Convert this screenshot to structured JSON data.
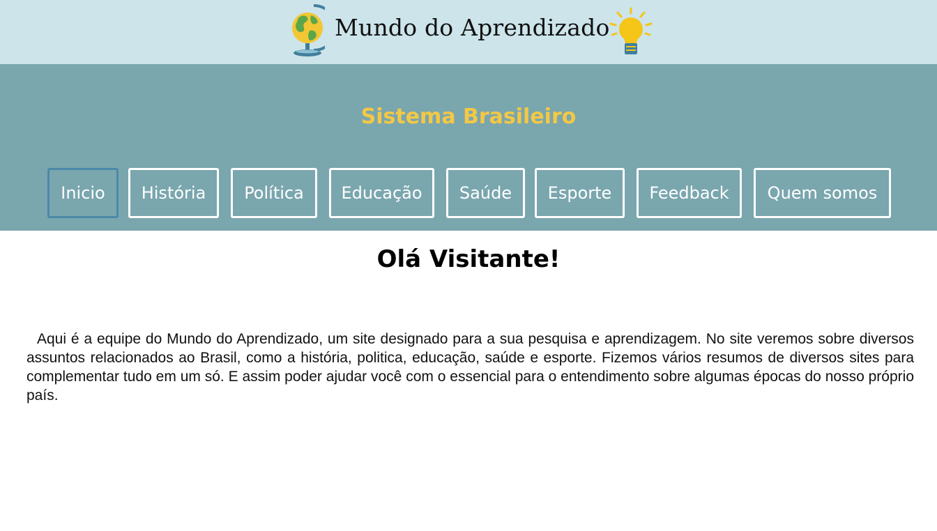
{
  "header": {
    "brand_name": "Mundo do Aprendizado",
    "background": "#cce4ea",
    "logo_left_icon": "globe-icon",
    "logo_right_icon": "light-bulb-icon"
  },
  "nav": {
    "section_title": "Sistema Brasileiro",
    "title_color": "#f3c845",
    "background": "#7aa6ae",
    "active_item": "Inicio",
    "items": [
      {
        "label": "Inicio"
      },
      {
        "label": "História"
      },
      {
        "label": "Política"
      },
      {
        "label": "Educação"
      },
      {
        "label": "Saúde"
      },
      {
        "label": "Esporte"
      },
      {
        "label": "Feedback"
      },
      {
        "label": "Quem somos"
      }
    ]
  },
  "main": {
    "greeting": "Olá Visitante!",
    "intro": "Aqui é a equipe do Mundo do Aprendizado, um site designado para a sua pesquisa e aprendizagem. No site veremos sobre diversos assuntos relacionados ao Brasil, como a história, politica, educação, saúde e esporte. Fizemos vários resumos de diversos sites para complementar tudo em um só. E assim poder ajudar você com o essencial para o entendimento sobre algumas épocas do nosso próprio país."
  }
}
